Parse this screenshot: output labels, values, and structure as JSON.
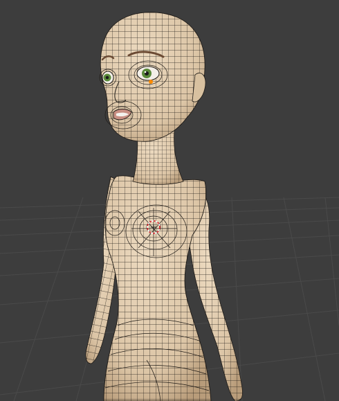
{
  "viewport": {
    "background": "#3d3d3d",
    "grid_color": "#4a4a4a"
  },
  "model": {
    "skin_color": "#e2cdb0",
    "skin_shade": "#c9b08f",
    "wire_color": "#1e1a16",
    "iris_color": "#5a8a3a",
    "brow_color": "#6b4a33",
    "lip_color": "#c98f83",
    "vertex_highlight": "#ff8c00",
    "cursor_color": "#e0242e"
  }
}
